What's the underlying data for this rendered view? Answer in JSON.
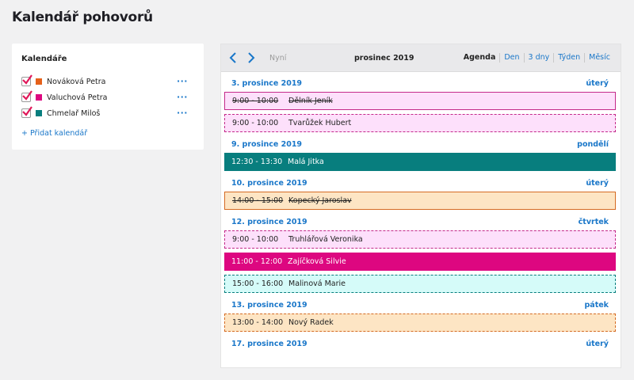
{
  "page": {
    "title": "Kalendář pohovorů"
  },
  "sidebar": {
    "heading": "Kalendáře",
    "calendars": [
      {
        "name": "Nováková Petra",
        "color": "#e5611a",
        "checked": true
      },
      {
        "name": "Valuchová Petra",
        "color": "#dd0780",
        "checked": true
      },
      {
        "name": "Chmelař Miloš",
        "color": "#087e7e",
        "checked": true
      }
    ],
    "more_label": "···",
    "add_label": "+ Přidat kalendář"
  },
  "toolbar": {
    "prev_icon": "chevron-left-icon",
    "next_icon": "chevron-right-icon",
    "now_label": "Nyní",
    "month_label": "prosinec 2019",
    "views": [
      "Agenda",
      "Den",
      "3 dny",
      "Týden",
      "Měsíc"
    ],
    "active_view": "Agenda"
  },
  "agenda": {
    "days": [
      {
        "date": "3. prosince 2019",
        "weekday": "úterý",
        "events": [
          {
            "time": "9:00 - 10:00",
            "name": "Dělník Jeník",
            "style": "pink-solid",
            "cancelled": true
          },
          {
            "time": "9:00 - 10:00",
            "name": "Tvarůžek Hubert",
            "style": "pink-dash",
            "cancelled": false
          }
        ]
      },
      {
        "date": "9. prosince 2019",
        "weekday": "pondělí",
        "events": [
          {
            "time": "12:30 - 13:30",
            "name": "Malá Jitka",
            "style": "teal",
            "cancelled": false
          }
        ]
      },
      {
        "date": "10. prosince 2019",
        "weekday": "úterý",
        "events": [
          {
            "time": "14:00 - 15:00",
            "name": "Kopecký Jaroslav",
            "style": "orange-solid",
            "cancelled": true
          }
        ]
      },
      {
        "date": "12. prosince 2019",
        "weekday": "čtvrtek",
        "events": [
          {
            "time": "9:00 - 10:00",
            "name": "Truhlářová Veronika",
            "style": "pink-dash",
            "cancelled": false
          },
          {
            "time": "11:00 - 12:00",
            "name": "Zajíčková Silvie",
            "style": "magenta",
            "cancelled": false
          },
          {
            "time": "15:00 - 16:00",
            "name": "Malinová Marie",
            "style": "cyan-dash",
            "cancelled": false
          }
        ]
      },
      {
        "date": "13. prosince 2019",
        "weekday": "pátek",
        "events": [
          {
            "time": "13:00 - 14:00",
            "name": "Nový Radek",
            "style": "orange-dash",
            "cancelled": false
          }
        ]
      },
      {
        "date": "17. prosince 2019",
        "weekday": "úterý",
        "events": []
      }
    ]
  }
}
